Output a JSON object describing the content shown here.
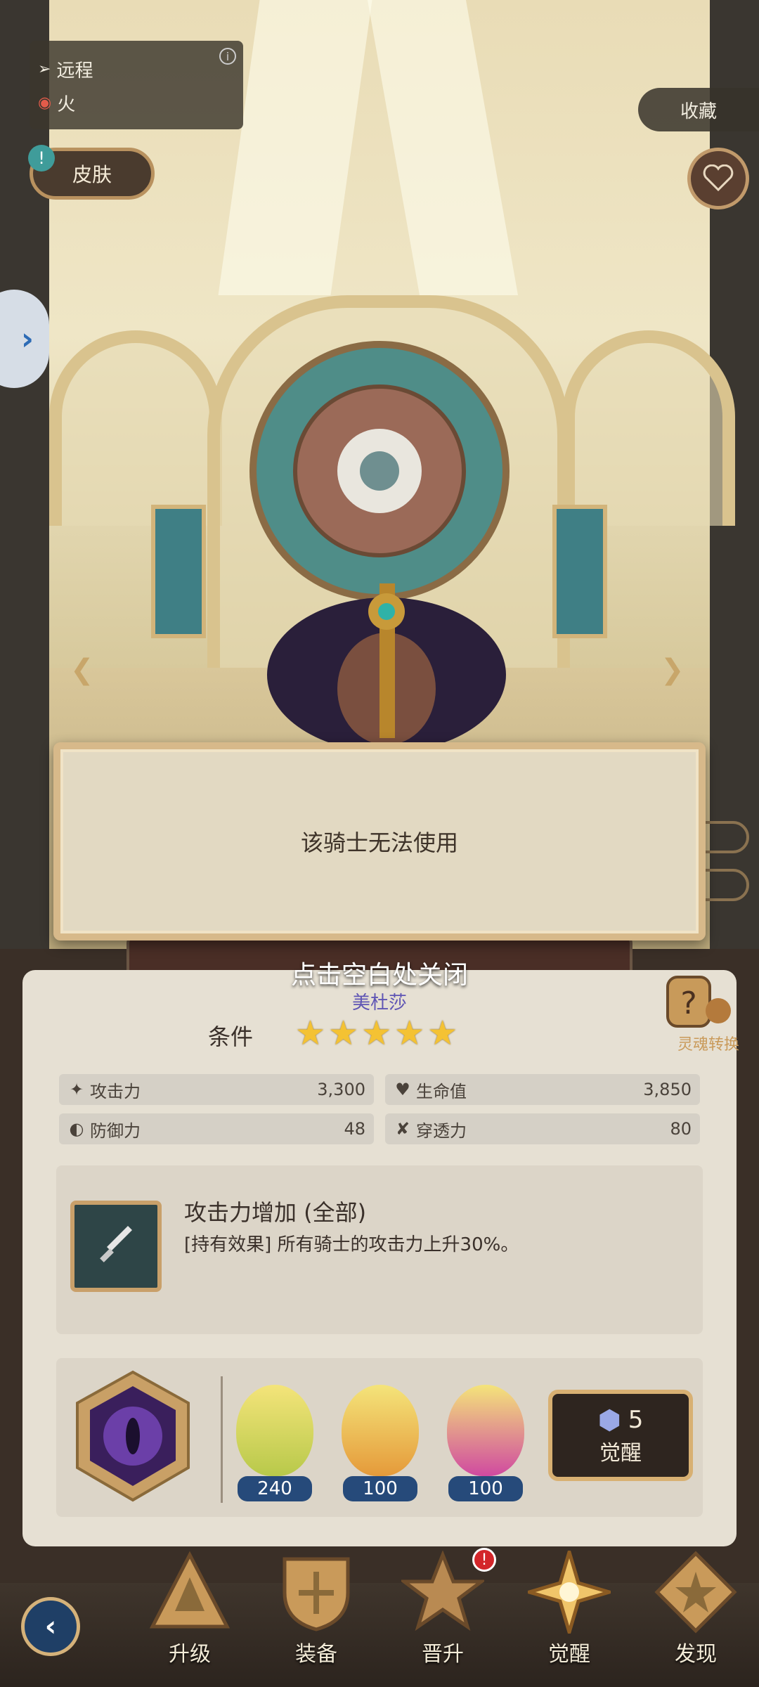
{
  "traits": {
    "range_label": "远程",
    "element_label": "火"
  },
  "buttons": {
    "skin": "皮肤",
    "collect": "收藏"
  },
  "dialog": {
    "message": "该骑士无法使用",
    "close_hint": "点击空白处关闭"
  },
  "character": {
    "name": "美杜莎",
    "condition_label": "条件",
    "stars": 5
  },
  "soul_convert": {
    "label": "灵魂转换"
  },
  "stats": [
    {
      "icon": "sword-icon",
      "label": "攻击力",
      "value": "3,300"
    },
    {
      "icon": "heart-icon",
      "label": "生命值",
      "value": "3,850"
    },
    {
      "icon": "shield-icon",
      "label": "防御力",
      "value": "48"
    },
    {
      "icon": "pierce-icon",
      "label": "穿透力",
      "value": "80"
    }
  ],
  "skill": {
    "title": "攻击力增加 (全部)",
    "description": "[持有效果] 所有骑士的攻击力上升30%。"
  },
  "awaken": {
    "materials": [
      {
        "name": "medusa-shard",
        "count": "240"
      },
      {
        "name": "hero-shard-orange",
        "count": "100"
      },
      {
        "name": "hero-shard-pink",
        "count": "100"
      }
    ],
    "cost": "5",
    "button_label": "觉醒"
  },
  "nav": {
    "items": [
      {
        "label": "升级"
      },
      {
        "label": "装备"
      },
      {
        "label": "晋升",
        "badge": "!"
      },
      {
        "label": "觉醒"
      },
      {
        "label": "发现"
      }
    ]
  },
  "colors": {
    "star": "#f4c233",
    "name": "#5f55b4",
    "accent_gold": "#d8b072",
    "badge": "#d3262a"
  }
}
